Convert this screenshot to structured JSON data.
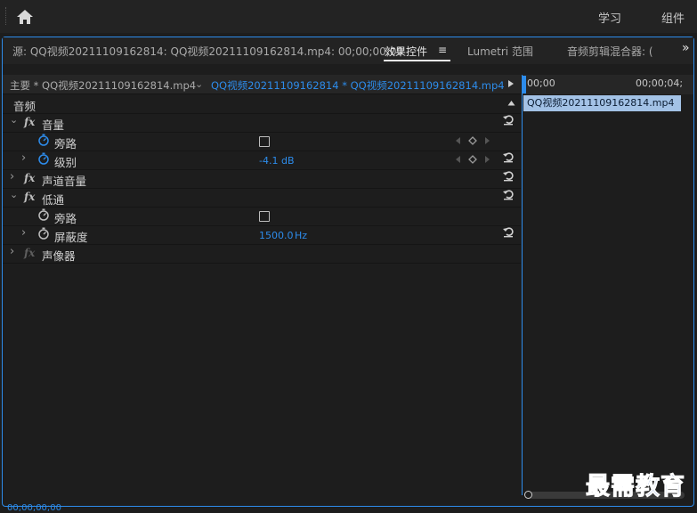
{
  "topbar": {
    "nav": [
      "学习",
      "组件"
    ]
  },
  "tabs": {
    "source": "源: QQ视频20211109162814: QQ视频20211109162814.mp4: 00;00;00;00",
    "effect_controls": "效果控件",
    "menu_glyph": "≡",
    "lumetri": "Lumetri 范围",
    "audio_mixer": "音频剪辑混合器: (",
    "overflow": "»"
  },
  "clip_header": {
    "master": "主要 * QQ视频20211109162814.mp4",
    "clip": "QQ视频20211109162814 * QQ视频20211109162814.mp4"
  },
  "effects": {
    "section": "音频",
    "volume": "音量",
    "bypass": "旁路",
    "level": "级别",
    "level_value": "-4.1 dB",
    "channel_volume": "声道音量",
    "lowpass": "低通",
    "bypass2": "旁路",
    "cutoff": "屏蔽度",
    "cutoff_value": "1500.0",
    "cutoff_unit": "Hz",
    "panner": "声像器",
    "fx_label": "fx"
  },
  "timeline": {
    "tc_start": "00;00",
    "tc_end": "00;00;04;",
    "clip_label": "QQ视频20211109162814.mp4"
  },
  "footer": {
    "timecode": "00;00;00;00"
  },
  "watermark": "最需教育",
  "colors": {
    "accent": "#2d8ceb",
    "clip_bar": "#a3c2e6",
    "background": "#1d1d1d"
  }
}
